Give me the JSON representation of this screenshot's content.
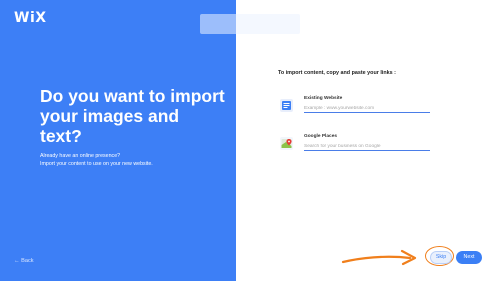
{
  "brand": {
    "logo": "WiX"
  },
  "left": {
    "headline": "Do you want to import your images and text?",
    "sub_line1": "Already have an online presence?",
    "sub_line2": "Import your content to use on your new website.",
    "back_label": "← Back"
  },
  "right": {
    "prompt": "To import content, copy and paste your links :",
    "existing": {
      "label": "Existing Website",
      "placeholder": "Example : www.yourwebsite.com",
      "value": ""
    },
    "google": {
      "label": "Google Places",
      "placeholder": "Search for your business on Google",
      "value": ""
    }
  },
  "actions": {
    "skip_label": "Skip",
    "next_label": "Next"
  },
  "colors": {
    "accent": "#3d7ff6",
    "annotation": "#f07f1c"
  },
  "icons": {
    "existing": "website-icon",
    "google": "map-pin-icon"
  }
}
